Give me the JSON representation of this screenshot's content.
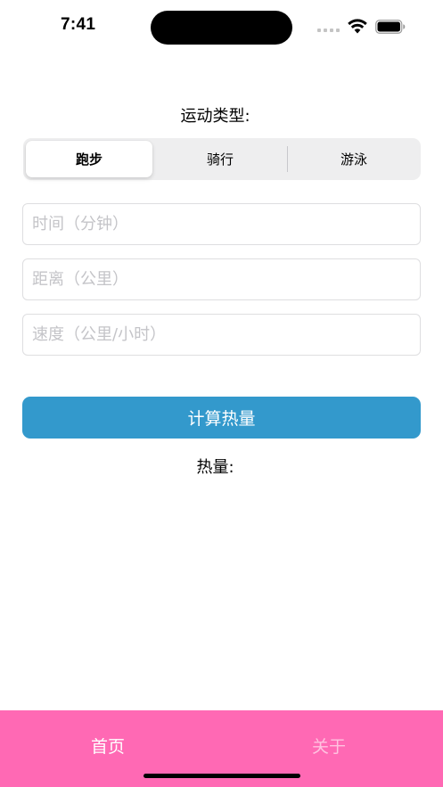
{
  "status_bar": {
    "time": "7:41",
    "icons": [
      "signal-icon",
      "wifi-icon",
      "battery-icon"
    ]
  },
  "form": {
    "type_label": "运动类型:",
    "segments": [
      {
        "label": "跑步",
        "selected": true
      },
      {
        "label": "骑行",
        "selected": false
      },
      {
        "label": "游泳",
        "selected": false
      }
    ],
    "time_field": {
      "value": "",
      "placeholder": "时间（分钟）"
    },
    "distance_field": {
      "value": "",
      "placeholder": "距离（公里）"
    },
    "speed_field": {
      "value": "",
      "placeholder": "速度（公里/小时）"
    },
    "calculate_label": "计算热量",
    "result_label": "热量:"
  },
  "tab_bar": {
    "items": [
      {
        "label": "首页",
        "active": true
      },
      {
        "label": "关于",
        "active": false
      }
    ]
  },
  "colors": {
    "accent_button": "#3399cc",
    "tab_bar_background": "#ff69b4",
    "tab_active": "#ffffff",
    "tab_inactive": "#ffc2e0",
    "segment_background": "#eeeeef"
  }
}
